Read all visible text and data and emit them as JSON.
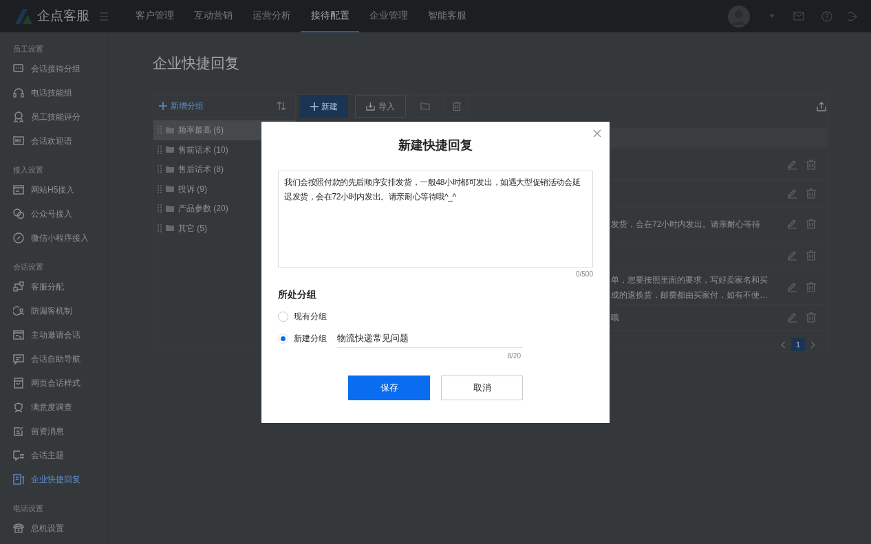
{
  "app": {
    "name": "企点客服"
  },
  "nav_tabs": [
    {
      "label": "客户管理",
      "selected": false
    },
    {
      "label": "互动营销",
      "selected": false
    },
    {
      "label": "运营分析",
      "selected": false
    },
    {
      "label": "接待配置",
      "selected": true
    },
    {
      "label": "企业管理",
      "selected": false
    },
    {
      "label": "智能客服",
      "selected": false
    }
  ],
  "sidebar": {
    "sections": [
      {
        "title": "员工设置",
        "items": [
          {
            "label": "会话接待分组",
            "selected": false
          },
          {
            "label": "电话技能组",
            "selected": false
          },
          {
            "label": "员工技能评分",
            "selected": false
          },
          {
            "label": "会话欢迎语",
            "selected": false
          }
        ]
      },
      {
        "title": "接入设置",
        "items": [
          {
            "label": "网站H5接入",
            "selected": false
          },
          {
            "label": "公众号接入",
            "selected": false
          },
          {
            "label": "微信小程序接入",
            "selected": false
          }
        ]
      },
      {
        "title": "会话设置",
        "items": [
          {
            "label": "客服分配",
            "selected": false
          },
          {
            "label": "防漏客机制",
            "selected": false
          },
          {
            "label": "主动邀请会话",
            "selected": false
          },
          {
            "label": "会话自助导航",
            "selected": false
          },
          {
            "label": "网页会话样式",
            "selected": false
          },
          {
            "label": "满意度调查",
            "selected": false
          },
          {
            "label": "留资消息",
            "selected": false
          },
          {
            "label": "会话主题",
            "selected": false
          },
          {
            "label": "企业快捷回复",
            "selected": true
          }
        ]
      },
      {
        "title": "电话设置",
        "items": [
          {
            "label": "总机设置",
            "selected": false
          }
        ]
      }
    ]
  },
  "page_title": "企业快捷回复",
  "group_panel": {
    "add_label": "新增分组",
    "groups": [
      {
        "label": "频率最高 (6)",
        "selected": true
      },
      {
        "label": "售前话术 (10)",
        "selected": false
      },
      {
        "label": "售后话术 (8)",
        "selected": false
      },
      {
        "label": "投诉 (9)",
        "selected": false
      },
      {
        "label": "产品参数 (20)",
        "selected": false
      },
      {
        "label": "其它 (5)",
        "selected": false
      }
    ]
  },
  "toolbar": {
    "new_label": "新建",
    "import_label": "导入"
  },
  "table_rows": [
    {
      "lines": []
    },
    {
      "lines": []
    },
    {
      "lines": [
        "发货，会在72小时内发出。请亲耐心等待"
      ]
    },
    {
      "lines": []
    },
    {
      "lines": [
        "单，您要按照里面的要求，写好卖家名和买",
        "成的退换货，邮费都由买家付，如有不便…"
      ]
    },
    {
      "lines": [
        "哦"
      ]
    }
  ],
  "pagination": {
    "pages": [
      {
        "label": "1",
        "selected": true
      }
    ]
  },
  "dialog": {
    "title": "新建快捷回复",
    "content": "我们会按照付款的先后顺序安排发货，一般48小时都可发出，如遇大型促销活动会延迟发货，会在72小时内发出。请亲耐心等待哦^_^",
    "content_counter": "0/500",
    "group_label": "所处分组",
    "group_options": [
      {
        "kind": "plain",
        "label": "现有分组",
        "selected": false
      },
      {
        "kind": "with_input",
        "label": "新建分组",
        "selected": true,
        "value": "物流快递常见问题",
        "counter": "8/20"
      }
    ],
    "buttons": [
      {
        "kind": "primary",
        "label": "保存"
      },
      {
        "kind": "secondary",
        "label": "取消"
      }
    ]
  }
}
